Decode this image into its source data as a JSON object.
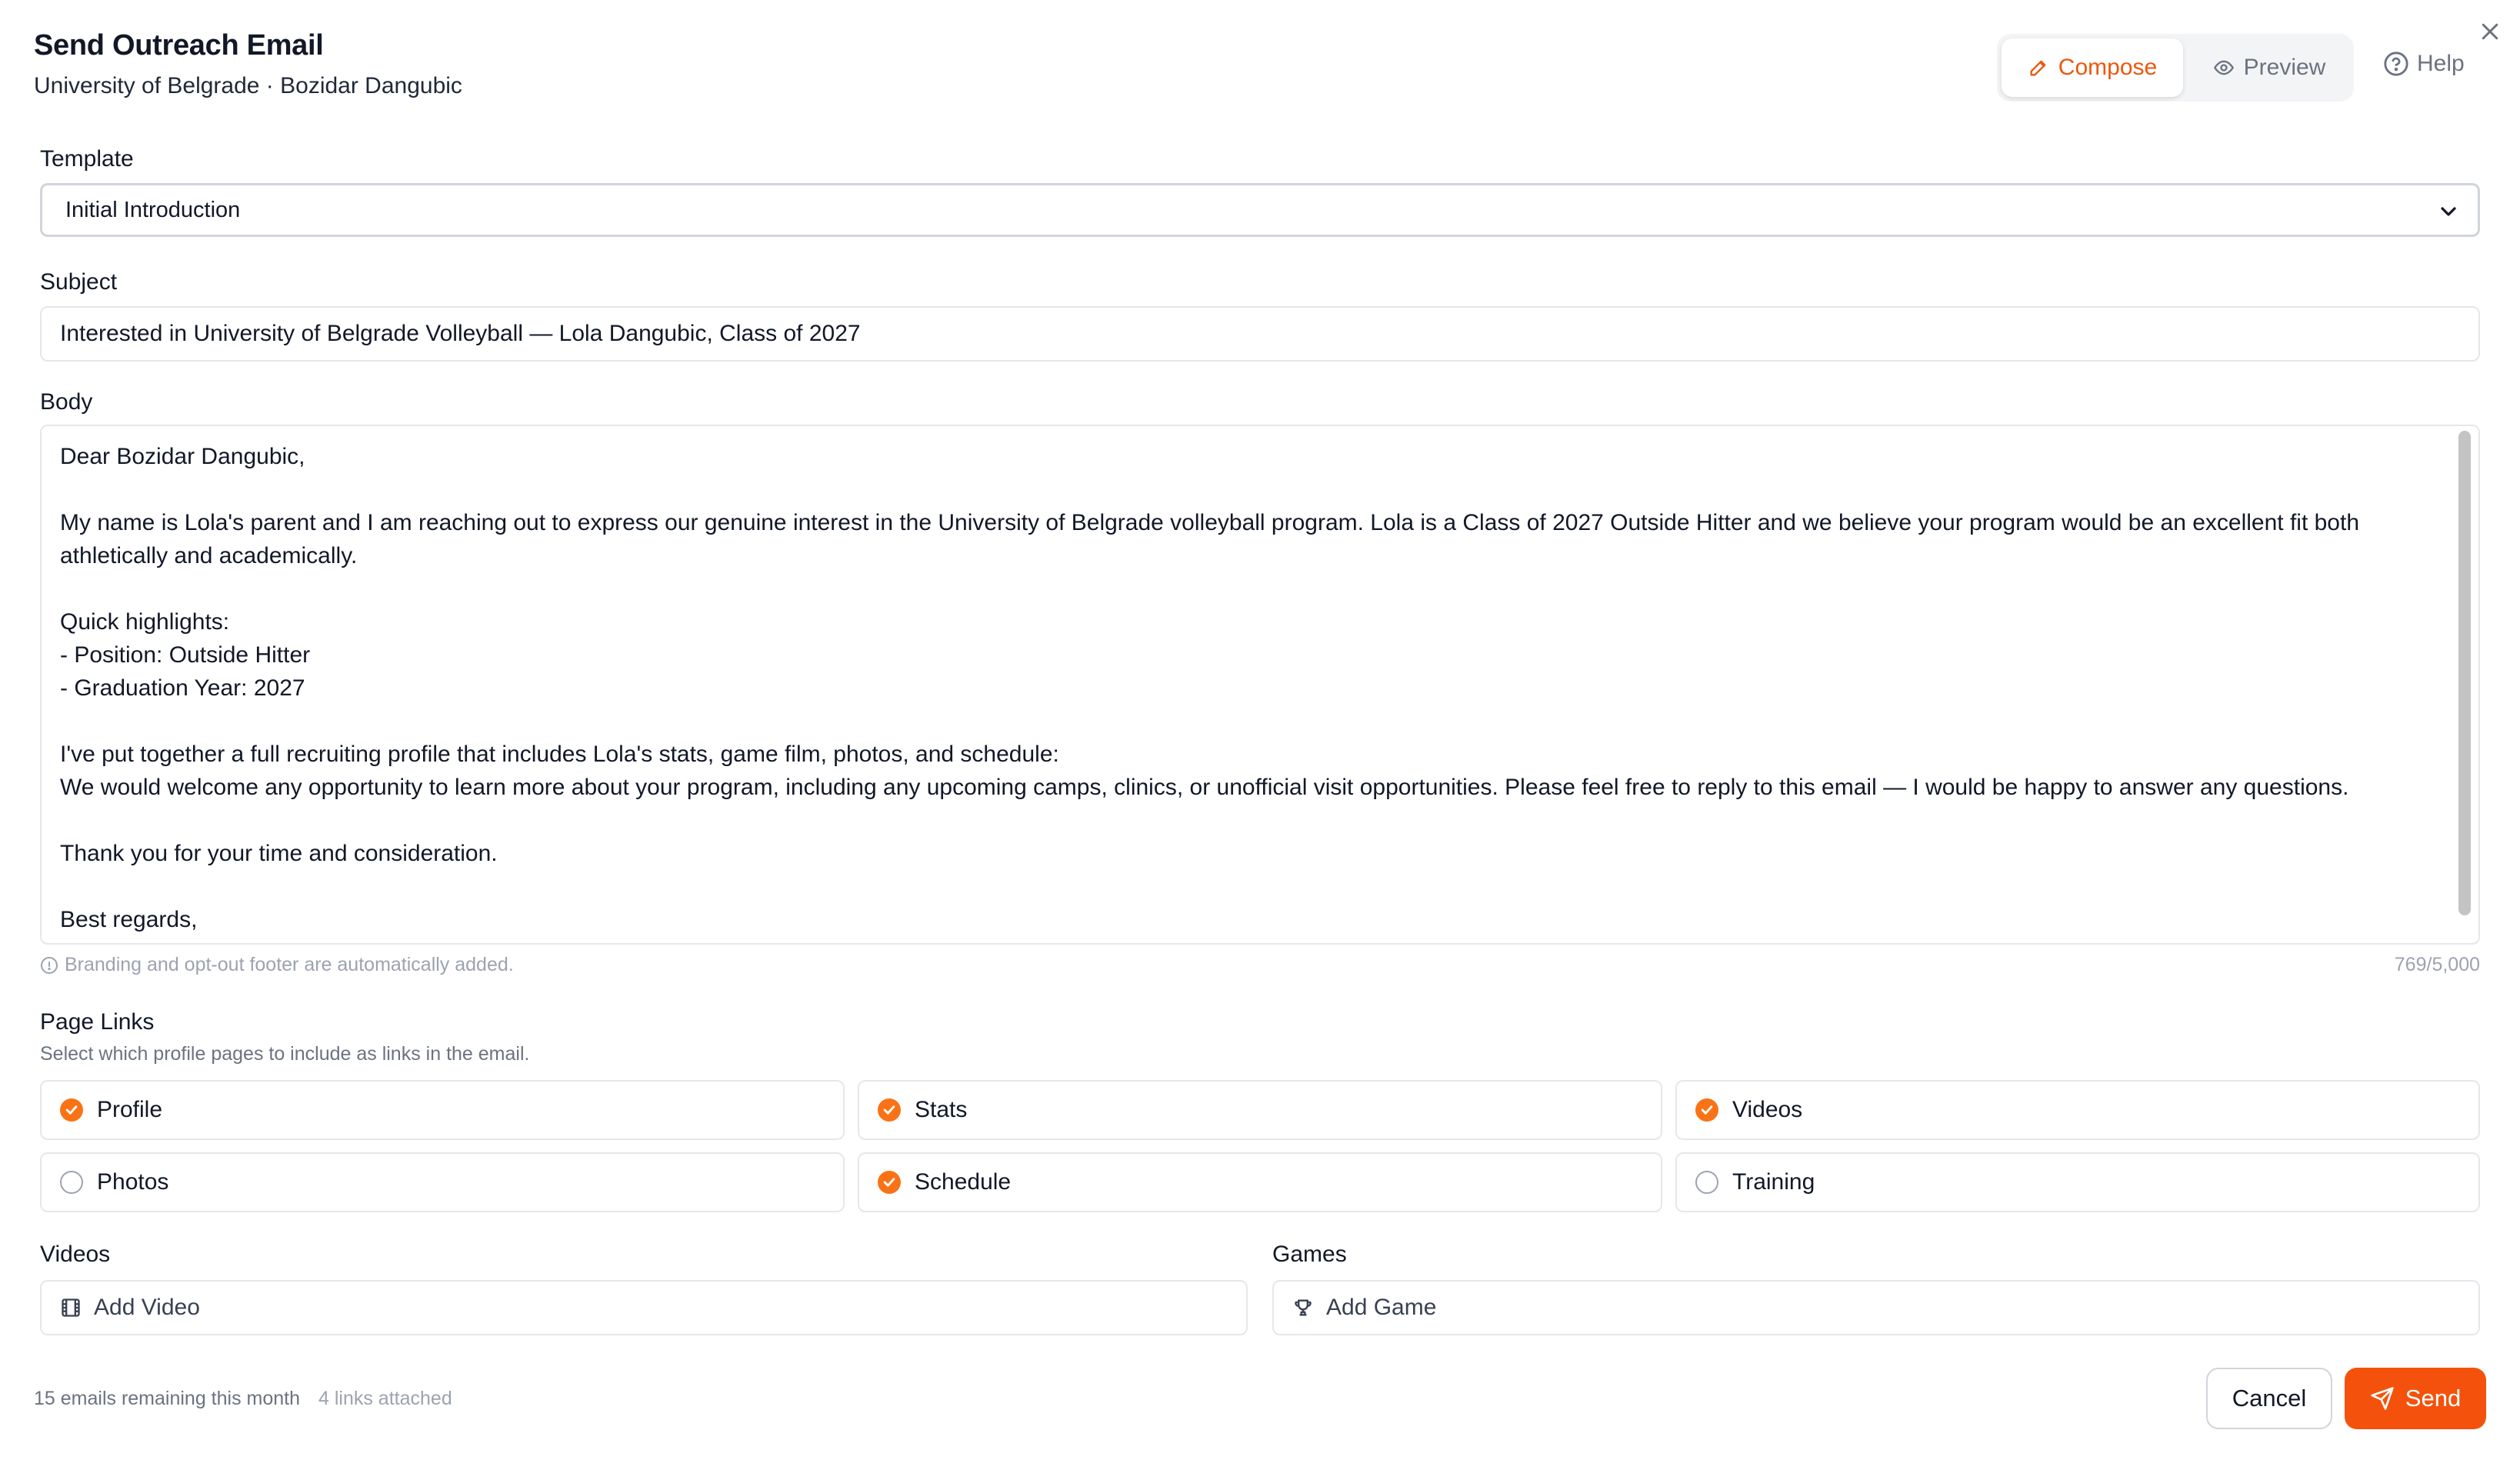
{
  "header": {
    "title": "Send Outreach Email",
    "subtitle": "University of Belgrade · Bozidar Dangubic",
    "tabs": [
      {
        "label": "Compose",
        "icon": "pencil-icon",
        "active": true
      },
      {
        "label": "Preview",
        "icon": "eye-icon",
        "active": false
      }
    ],
    "help_label": "Help"
  },
  "template": {
    "label": "Template",
    "selected": "Initial Introduction"
  },
  "subject": {
    "label": "Subject",
    "value": "Interested in University of Belgrade Volleyball — Lola Dangubic, Class of 2027"
  },
  "body": {
    "label": "Body",
    "value": "Dear Bozidar Dangubic,\n\nMy name is Lola's parent and I am reaching out to express our genuine interest in the University of Belgrade volleyball program. Lola is a Class of 2027 Outside Hitter and we believe your program would be an excellent fit both athletically and academically.\n\nQuick highlights:\n- Position: Outside Hitter\n- Graduation Year: 2027\n\nI've put together a full recruiting profile that includes Lola's stats, game film, photos, and schedule:\nWe would welcome any opportunity to learn more about your program, including any upcoming camps, clinics, or unofficial visit opportunities. Please feel free to reply to this email — I would be happy to answer any questions.\n\nThank you for your time and consideration.\n\nBest regards,\nThe family of Lola Dangubic",
    "hint": "Branding and opt-out footer are automatically added.",
    "char_count": "769/5,000"
  },
  "page_links": {
    "label": "Page Links",
    "description": "Select which profile pages to include as links in the email.",
    "items": [
      {
        "label": "Profile",
        "checked": true
      },
      {
        "label": "Stats",
        "checked": true
      },
      {
        "label": "Videos",
        "checked": true
      },
      {
        "label": "Photos",
        "checked": false
      },
      {
        "label": "Schedule",
        "checked": true
      },
      {
        "label": "Training",
        "checked": false
      }
    ]
  },
  "videos": {
    "label": "Videos",
    "add_label": "Add Video",
    "icon": "film-icon"
  },
  "games": {
    "label": "Games",
    "add_label": "Add Game",
    "icon": "trophy-icon"
  },
  "footer": {
    "emails_remaining": "15 emails remaining this month",
    "links_attached": "4 links attached",
    "cancel_label": "Cancel",
    "send_label": "Send"
  },
  "colors": {
    "accent": "#f4520c",
    "checkbox": "#f97316",
    "border": "#e5e7eb"
  }
}
